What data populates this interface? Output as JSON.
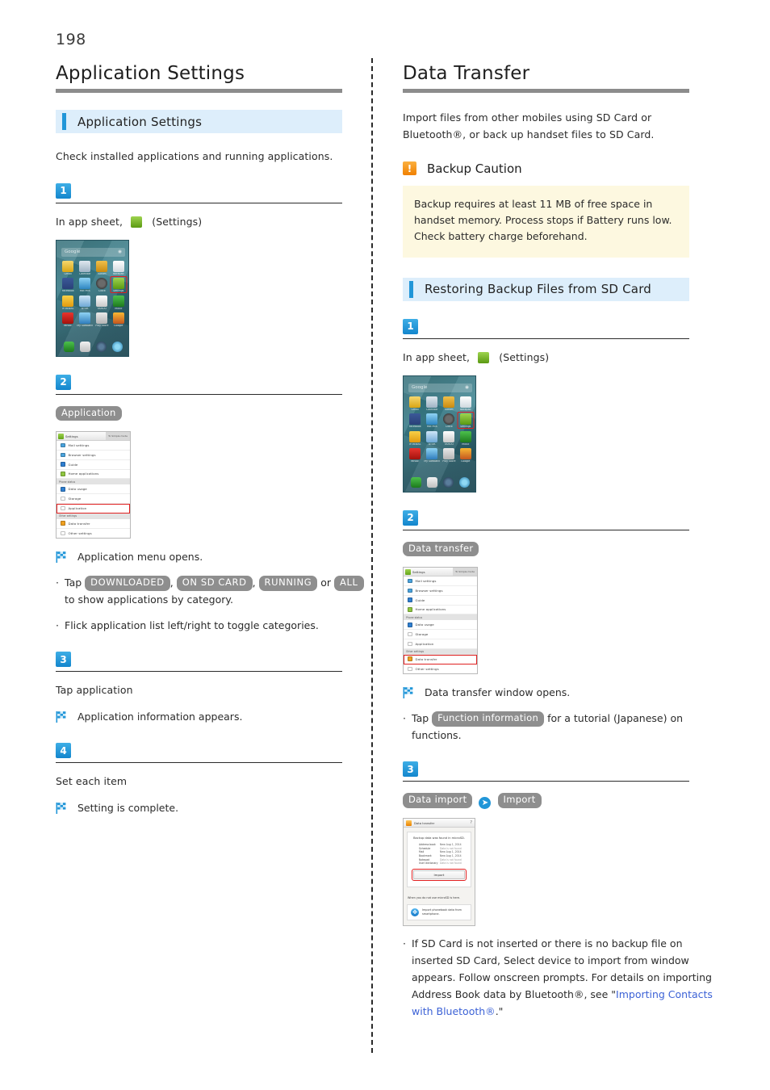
{
  "page": {
    "number": "198"
  },
  "left": {
    "chapter_title": "Application Settings",
    "section_title": "Application Settings",
    "lead": "Check installed applications and running applications.",
    "steps": [
      {
        "num": "1",
        "instruction_pre": "In app sheet,",
        "instruction_post": "(Settings)"
      },
      {
        "num": "2",
        "token": "Application",
        "result": "Application menu opens.",
        "bullets": [
          {
            "pre": "Tap",
            "tokens": [
              "DOWNLOADED",
              "ON SD CARD",
              "RUNNING",
              "ALL"
            ],
            "sep1": ",",
            "sep2": ",",
            "or": "or",
            "post": "to show applications by category."
          },
          {
            "text": "Flick application list left/right to toggle categories."
          }
        ]
      },
      {
        "num": "3",
        "instruction": "Tap application",
        "result": "Application information appears."
      },
      {
        "num": "4",
        "instruction": "Set each item",
        "result": "Setting is complete."
      }
    ]
  },
  "right": {
    "chapter_title": "Data Transfer",
    "lead": "Import files from other mobiles using SD Card or Bluetooth®, or back up handset files to SD Card.",
    "caution": {
      "icon": "!",
      "title": "Backup Caution",
      "body": "Backup requires at least 11 MB of free space in handset memory. Process stops if Battery runs low. Check battery charge beforehand."
    },
    "section_title": "Restoring Backup Files from SD Card",
    "steps": [
      {
        "num": "1",
        "instruction_pre": "In app sheet,",
        "instruction_post": "(Settings)"
      },
      {
        "num": "2",
        "token": "Data transfer",
        "result": "Data transfer window opens.",
        "bullet": {
          "pre": "Tap",
          "token": "Function information",
          "post": "for a tutorial (Japanese) on functions."
        }
      },
      {
        "num": "3",
        "token1": "Data import",
        "token2": "Import",
        "note": {
          "text1": "If SD Card is not inserted or there is no backup file on inserted SD Card, Select device to import from window appears. Follow onscreen prompts. For details on importing Address Book data by Bluetooth®, see \"",
          "link": "Importing Contacts with Bluetooth®",
          "text2": ".\""
        }
      }
    ]
  },
  "phone_home": {
    "search_placeholder": "Google",
    "mic_icon": "mic-icon",
    "apps": [
      {
        "label": "Gmail",
        "color1": "#f5d76e",
        "color2": "#d9a514"
      },
      {
        "label": "Calendar",
        "color1": "#dfe8ef",
        "color2": "#9fb3c4"
      },
      {
        "label": "Album",
        "color1": "#f0c04a",
        "color2": "#c98a10"
      },
      {
        "label": "Notepad",
        "color1": "#ffffff",
        "color2": "#cfd8de"
      },
      {
        "label": "Facebook",
        "color1": "#3b5998",
        "color2": "#2a4179"
      },
      {
        "label": "Hot Pics",
        "color1": "#8fd3f4",
        "color2": "#2e86c1"
      },
      {
        "label": "Clock",
        "color1": "#4a4a4a",
        "color2": "#111111"
      },
      {
        "label": "Settings",
        "color1": "#9ed34f",
        "color2": "#5b9a12",
        "selected": true
      },
      {
        "label": "iP-REBAS",
        "color1": "#f7d148",
        "color2": "#e29a0e"
      },
      {
        "label": "ATOK",
        "color1": "#cfe6f7",
        "color2": "#6fa9d6"
      },
      {
        "label": "YAHOO",
        "color1": "#ffffff",
        "color2": "#c9c9c9"
      },
      {
        "label": "Music",
        "color1": "#4cc14c",
        "color2": "#1e7a1e"
      },
      {
        "label": "Yahoo!",
        "color1": "#e8352e",
        "color2": "#a3120d"
      },
      {
        "label": "My Softbank",
        "color1": "#8fd3f4",
        "color2": "#2f7dbd"
      },
      {
        "label": "Play Store",
        "color1": "#e9e9e9",
        "color2": "#b5b5b5"
      },
      {
        "label": "Google",
        "color1": "#f7b733",
        "color2": "#c4551f"
      }
    ],
    "dock": [
      {
        "label": "phone-icon",
        "color1": "#4cc14c",
        "color2": "#1c7a1c"
      },
      {
        "label": "mail-icon",
        "color1": "#f2f2f2",
        "color2": "#c0c0c0"
      },
      {
        "label": "browser-icon",
        "color1": "#3e5c78",
        "color2": "#16283c"
      },
      {
        "label": "chrome-icon",
        "color1": "#63c3e8",
        "color2": "#1d76a8"
      }
    ]
  },
  "settings_screen": {
    "title": "Settings",
    "mode_button": "To Simple mode",
    "rows": [
      {
        "label": "Mail settings",
        "color": "#4aa3dd",
        "type": "row"
      },
      {
        "label": "Browser settings",
        "color": "#4aa3dd",
        "type": "row"
      },
      {
        "label": "Guide",
        "color": "#2f7fd0",
        "type": "row"
      },
      {
        "label": "Home applications",
        "color": "#8fc640",
        "type": "row"
      },
      {
        "label": "Phone status",
        "type": "section"
      },
      {
        "label": "Data usage",
        "color": "#2f7fd0",
        "type": "row"
      },
      {
        "label": "Storage",
        "color": "#ffffff",
        "type": "row"
      },
      {
        "label": "Application",
        "color": "#ffffff",
        "type": "row"
      },
      {
        "label": "Other settings",
        "type": "section"
      },
      {
        "label": "Data transfer",
        "color": "#f0a020",
        "type": "row"
      },
      {
        "label": "Other settings",
        "color": "#ffffff",
        "type": "row"
      }
    ],
    "highlight_left": "Application",
    "highlight_right": "Data transfer"
  },
  "data_transfer_dialog": {
    "title": "Data transfer",
    "help_icon": "?",
    "found_text": "Backup data was found in microSD.",
    "entries": [
      {
        "key": "Address book",
        "value": "New Aug 1, 2014",
        "found": true
      },
      {
        "key": "Schedule",
        "value": "Data is not found",
        "found": false
      },
      {
        "key": "Mail",
        "value": "New Aug 1, 2014",
        "found": true
      },
      {
        "key": "Bookmark",
        "value": "New Aug 1, 2014",
        "found": true
      },
      {
        "key": "Notepad",
        "value": "Data is not found",
        "found": false
      },
      {
        "key": "User dictionary",
        "value": "Data is not found",
        "found": false
      }
    ],
    "import_button": "Import",
    "note": "When you do not use microSD is here.",
    "bluetooth_icon": "bluetooth-icon",
    "bluetooth_text": "Import phonebook data from smartphone."
  },
  "colors": {
    "accent_blue": "#2196d8",
    "section_bg": "#ddeefb",
    "rule_gray": "#8c8c8c",
    "token_gray": "#8e8e8e",
    "caution_bg": "#fdf8e0",
    "warn_orange": "#f08000",
    "link_blue": "#3c62d6",
    "highlight_red": "#e02020"
  }
}
